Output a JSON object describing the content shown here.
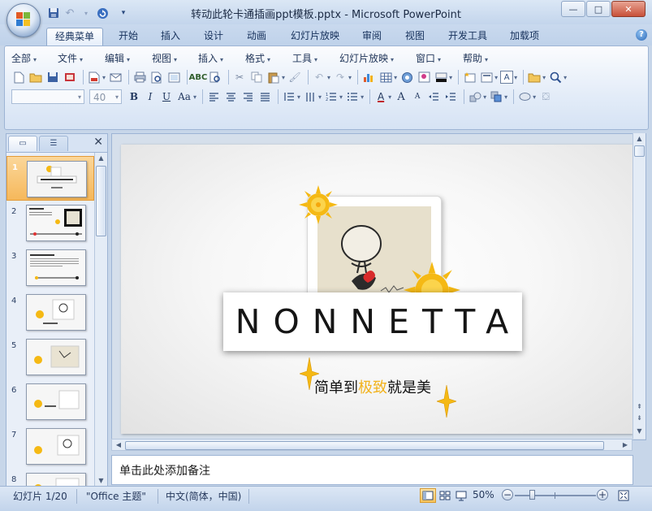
{
  "window": {
    "title": "转动此轮卡通插画ppt模板.pptx - Microsoft PowerPoint",
    "minimize": "—",
    "maximize": "□",
    "close": "✕"
  },
  "ribbon_tabs": [
    {
      "label": "经典菜单",
      "active": true
    },
    {
      "label": "开始"
    },
    {
      "label": "插入"
    },
    {
      "label": "设计"
    },
    {
      "label": "动画"
    },
    {
      "label": "幻灯片放映"
    },
    {
      "label": "审阅"
    },
    {
      "label": "视图"
    },
    {
      "label": "开发工具"
    },
    {
      "label": "加载项"
    }
  ],
  "help": "?",
  "classic_menu": [
    {
      "label": "全部"
    },
    {
      "label": "文件"
    },
    {
      "label": "编辑"
    },
    {
      "label": "视图"
    },
    {
      "label": "插入"
    },
    {
      "label": "格式"
    },
    {
      "label": "工具"
    },
    {
      "label": "幻灯片放映"
    },
    {
      "label": "窗口"
    },
    {
      "label": "帮助"
    }
  ],
  "format_bar": {
    "font_size": "40",
    "bold": "B",
    "italic": "I",
    "underline": "U",
    "case": "Aa",
    "text_color": "A",
    "grow": "A",
    "shrink": "A"
  },
  "slides": {
    "selected": 1,
    "numbers": [
      "1",
      "2",
      "3",
      "4",
      "5",
      "6",
      "7",
      "8"
    ]
  },
  "slide": {
    "title": "NONNETTA",
    "tagline_start": "简单到",
    "tagline_highlight": "极致",
    "tagline_end": "就是美",
    "highlight_color": "#f2b21c",
    "sun_color": "#f5b914"
  },
  "notes": {
    "placeholder": "单击此处添加备注"
  },
  "status": {
    "slide_info": "幻灯片 1/20",
    "theme": "\"Office 主题\"",
    "language": "中文(简体，中国)",
    "zoom": "50%",
    "zoom_fraction": 0.5
  },
  "colors": {
    "accent": "#f6b85b",
    "ribbon": "#c9d9ee"
  }
}
